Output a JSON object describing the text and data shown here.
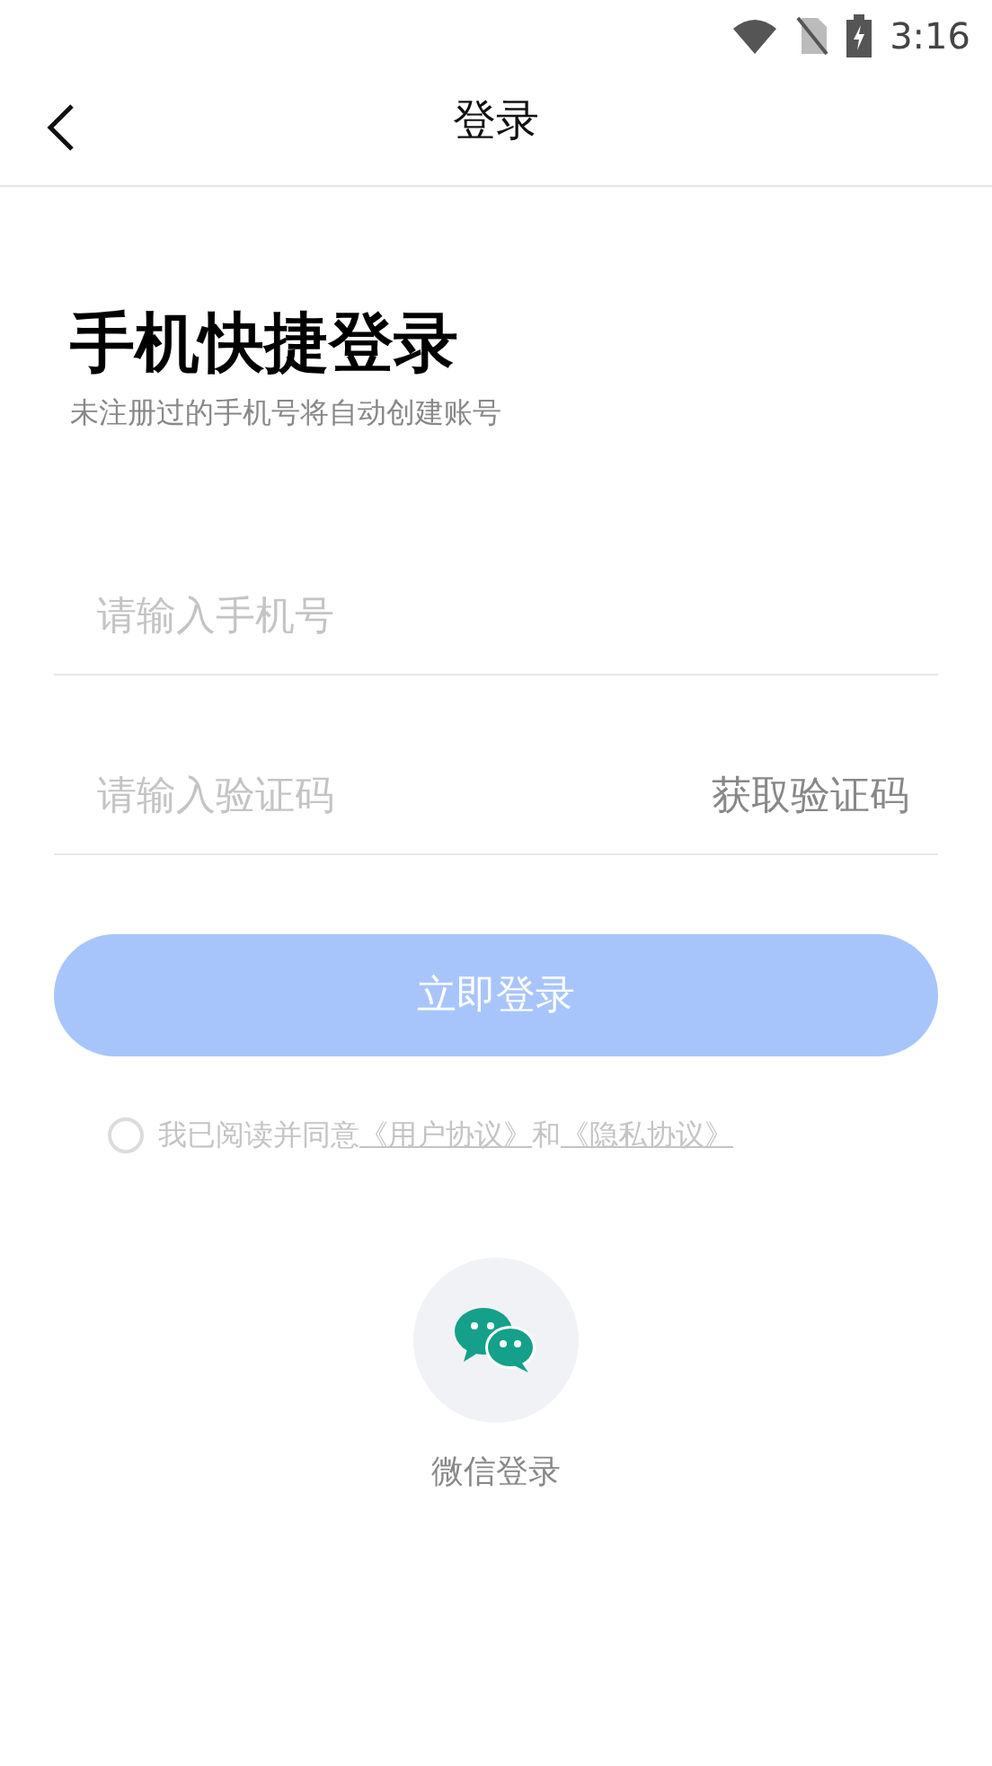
{
  "status_bar": {
    "time": "3:16"
  },
  "header": {
    "title": "登录"
  },
  "heading": "手机快捷登录",
  "subtitle": "未注册过的手机号将自动创建账号",
  "phone_field": {
    "placeholder": "请输入手机号"
  },
  "code_field": {
    "placeholder": "请输入验证码",
    "action": "获取验证码"
  },
  "login_button": {
    "label": "立即登录",
    "disabled": true
  },
  "agreement": {
    "checked": false,
    "text": "我已阅读并同意",
    "links": [
      "《用户协议》",
      "《隐私协议》"
    ],
    "joiner": "和"
  },
  "wechat_login": {
    "label": "微信登录"
  }
}
